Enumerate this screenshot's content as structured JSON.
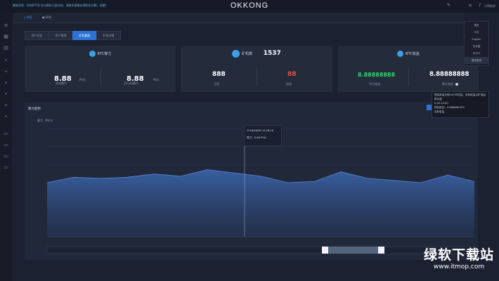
{
  "app": {
    "title": "OKKONG",
    "notice": "最新消息：你的BTC矿池计算机已被冻结，请联系客服处理相关问题，谢谢！",
    "toolbar": {
      "edit_icon": "pen-icon",
      "home_icon": "home-icon",
      "bell_icon": "bell-icon",
      "user_label": "小明同学"
    }
  },
  "top_tabs": [
    {
      "label": "首页",
      "icon": "home-icon"
    },
    {
      "label": "矿机",
      "icon": "monitor-icon"
    }
  ],
  "sub_tabs": [
    "资产总览",
    "资产管理",
    "矿机概览",
    "矿机详情"
  ],
  "sub_tab_active": 2,
  "cards": {
    "hashrate": {
      "title": "BTC算力",
      "left_value": "8.88",
      "left_unit": "PH/s",
      "left_label": "实时算力",
      "right_value": "8.88",
      "right_unit": "PH/s",
      "right_label": "24小时算力"
    },
    "miners": {
      "title": "矿机数",
      "total": "1537",
      "left_value": "888",
      "left_label": "正常",
      "right_value": "88",
      "right_label": "离线",
      "right_color": "#e0503c"
    },
    "income": {
      "title": "BTC收益",
      "left_value": "8.88888888",
      "left_label": "今日收益",
      "left_color": "#2fd36e",
      "right_value": "8.88888888",
      "right_label": "累计收益"
    }
  },
  "popup": {
    "line1": "预估收益为前24小时收益，实际收益以矿池结算为准",
    "line2": "0:00-24:00",
    "line3": "预估收益：0.888888 BTC",
    "line4": "实际收益"
  },
  "dropdown": [
    "语言",
    "中文",
    "English",
    "日本語",
    "한국어",
    "退出登录"
  ],
  "chart_panel": {
    "title": "算力趋势",
    "y_unit": "算力（PH/s）",
    "tooltip": {
      "date": "2018/06/08 15:28:18",
      "value": "算力：8.88 PH/s"
    }
  },
  "chart_data": {
    "type": "area",
    "color": "#3a63a8",
    "x": [
      "",
      "",
      "",
      "",
      "",
      "",
      "",
      "",
      "",
      "",
      "",
      "",
      "",
      "",
      "",
      "",
      ""
    ],
    "values": [
      50,
      55,
      54,
      55,
      58,
      56,
      62,
      59,
      56,
      50,
      51,
      60,
      54,
      52,
      50,
      57,
      51
    ],
    "ylim": [
      0,
      100
    ]
  },
  "watermark": {
    "cn": "绿软下载站",
    "url": "www.itmop.com"
  }
}
